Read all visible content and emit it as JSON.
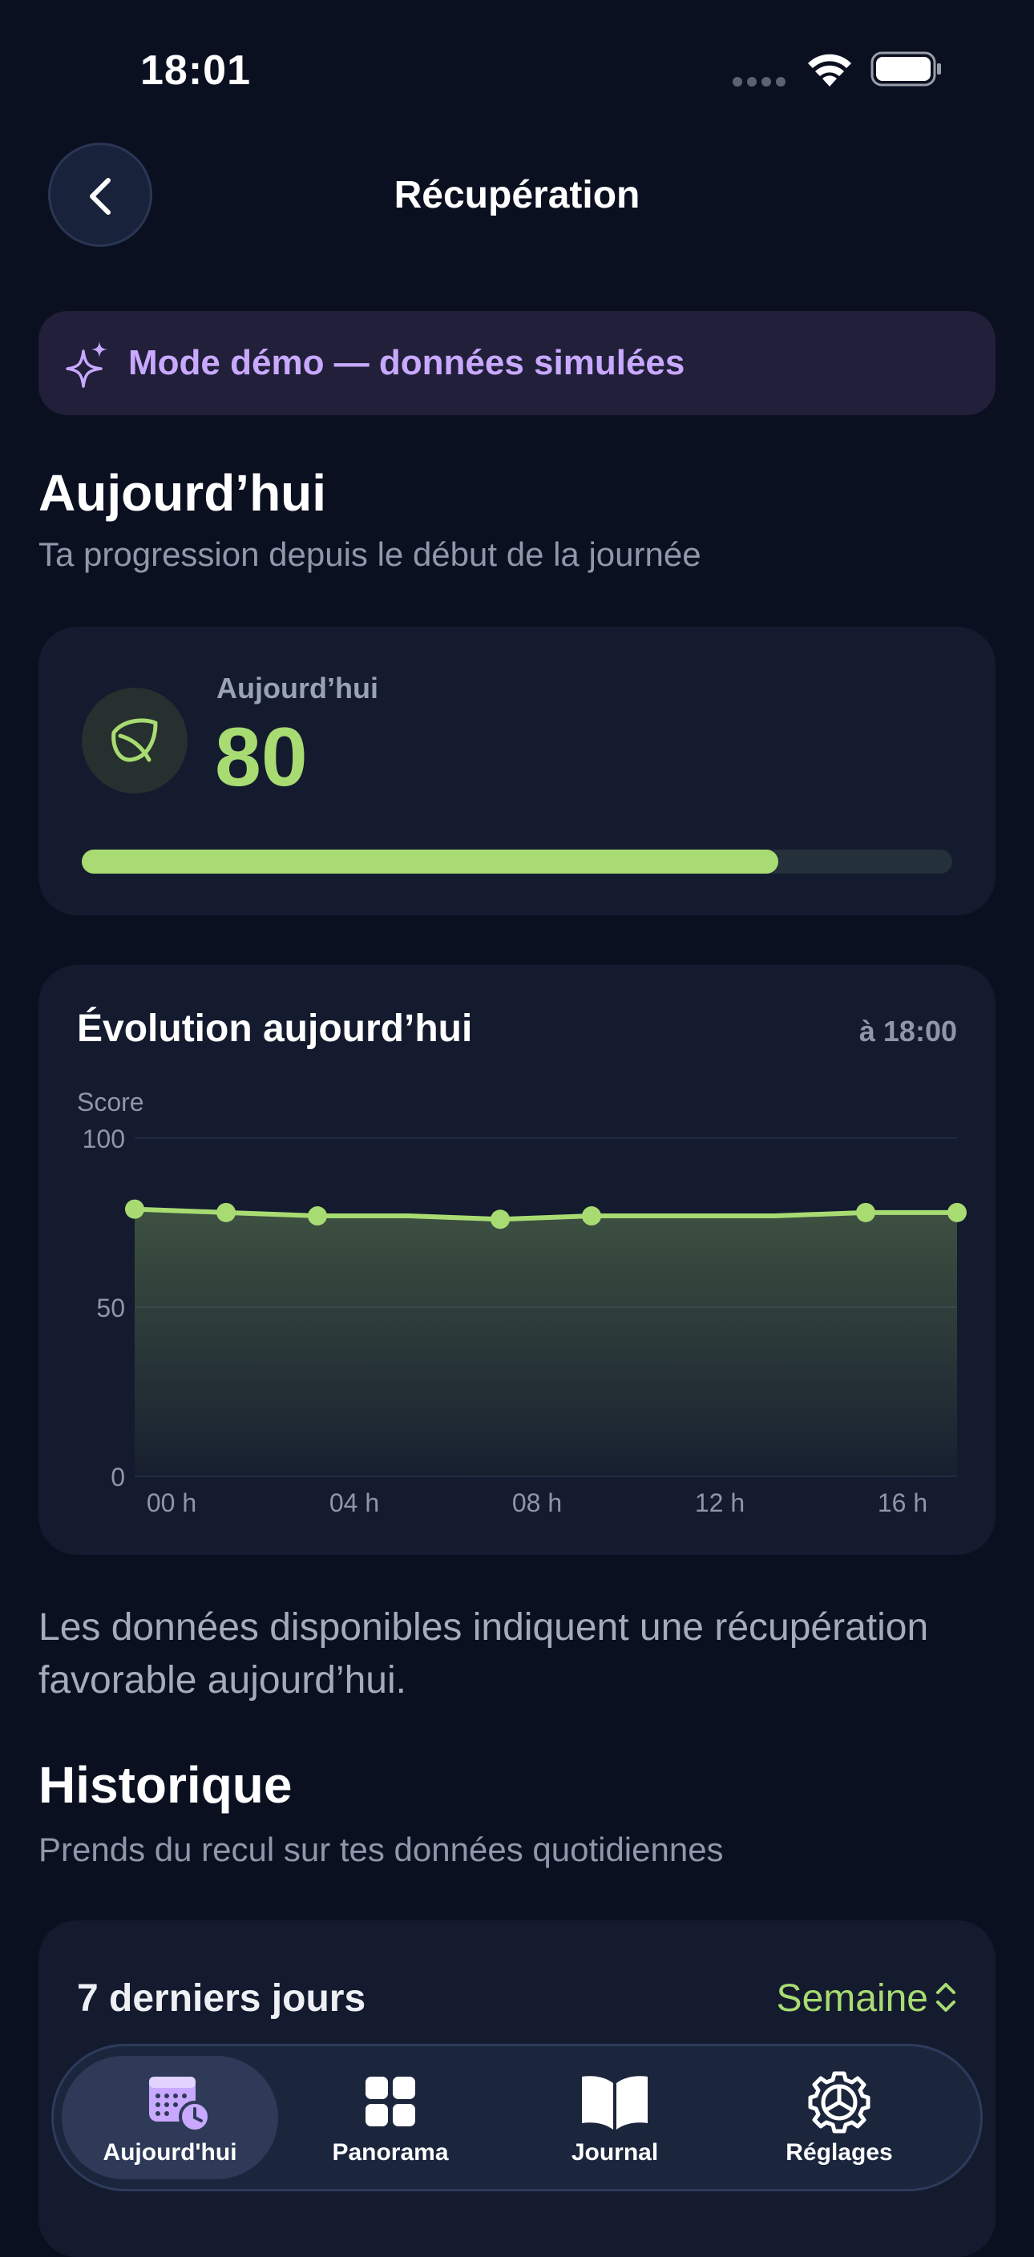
{
  "status_bar": {
    "time": "18:01"
  },
  "nav": {
    "title": "Récupération",
    "back_icon": "chevron-left-icon"
  },
  "demo_banner": {
    "text": "Mode démo — données simulées",
    "icon": "sparkle-icon",
    "color": "#c8a9ff"
  },
  "today_section": {
    "title": "Aujourd’hui",
    "subtitle": "Ta progression depuis le début de la journée"
  },
  "today_card": {
    "label": "Aujourd’hui",
    "score": "80",
    "progress": 0.8,
    "icon": "leaf-icon",
    "accent": "#a8dc72"
  },
  "chart_card": {
    "title": "Évolution aujourd’hui",
    "time_label": "à 18:00"
  },
  "chart_data": {
    "type": "area",
    "ylabel": "Score",
    "ylim": [
      0,
      100
    ],
    "yticks": [
      "0",
      "50",
      "100"
    ],
    "xlim": [
      0,
      18
    ],
    "xticks": [
      {
        "x": 0,
        "label": "00 h"
      },
      {
        "x": 4,
        "label": "04 h"
      },
      {
        "x": 8,
        "label": "08 h"
      },
      {
        "x": 12,
        "label": "12 h"
      },
      {
        "x": 16,
        "label": "16 h"
      }
    ],
    "points": [
      {
        "x": 0,
        "y": 79
      },
      {
        "x": 2,
        "y": 78
      },
      {
        "x": 4,
        "y": 77
      },
      {
        "x": 6,
        "y": 77,
        "marker": false
      },
      {
        "x": 8,
        "y": 76
      },
      {
        "x": 10,
        "y": 77
      },
      {
        "x": 14,
        "y": 77,
        "marker": false
      },
      {
        "x": 16,
        "y": 78
      },
      {
        "x": 18,
        "y": 78
      }
    ],
    "color": "#a8dc72",
    "grid": true
  },
  "summary": "Les données disponibles indiquent une récupération favorable aujourd’hui.",
  "history_section": {
    "title": "Historique",
    "subtitle": "Prends du recul sur tes données quotidiennes"
  },
  "history_card": {
    "title": "7 derniers jours",
    "period": "Semaine"
  },
  "tab_bar": {
    "tabs": [
      {
        "label": "Aujourd'hui",
        "icon": "calendar-clock-icon",
        "active": true
      },
      {
        "label": "Panorama",
        "icon": "grid-icon",
        "active": false
      },
      {
        "label": "Journal",
        "icon": "book-icon",
        "active": false
      },
      {
        "label": "Réglages",
        "icon": "gear-icon",
        "active": false
      }
    ]
  }
}
